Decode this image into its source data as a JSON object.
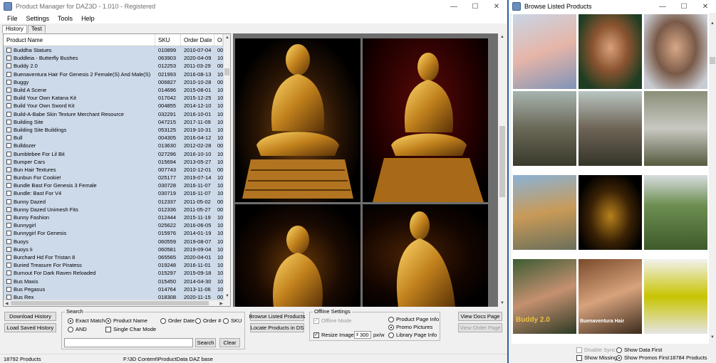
{
  "main": {
    "title": "Product Manager for DAZ3D  -  1.010  -  Registered",
    "menu": [
      "File",
      "Settings",
      "Tools",
      "Help"
    ],
    "tabs": [
      "History",
      "Test"
    ],
    "columns": [
      "Product Name",
      "SKU",
      "Order Date",
      "Or"
    ],
    "rows": [
      [
        "Buddha Statues",
        "010899",
        "2010-07-04",
        "00"
      ],
      [
        "Buddleia - Butterfly Bushes",
        "063903",
        "2020-04-09",
        "10"
      ],
      [
        "Buddy 2.0",
        "012253",
        "2011-03-29",
        "00"
      ],
      [
        "Buenaventura Hair For Genesis 2 Female(S) And Male(S)",
        "021993",
        "2016-08-13",
        "10"
      ],
      [
        "Buggy",
        "006827",
        "2010-10-28",
        "00"
      ],
      [
        "Build A Scene",
        "014696",
        "2015-08-01",
        "10"
      ],
      [
        "Build Your Own Katana Kit",
        "017042",
        "2015-12-25",
        "10"
      ],
      [
        "Build Your Own Sword Kit",
        "004855",
        "2014-12-10",
        "10"
      ],
      [
        "Build-A-Babe Skin Texture Merchant Resource",
        "032291",
        "2016-10-01",
        "10"
      ],
      [
        "Building Site",
        "047215",
        "2017-11-09",
        "10"
      ],
      [
        "Building Site Buildings",
        "053125",
        "2019-10-31",
        "10"
      ],
      [
        "Bull",
        "004305",
        "2016-04-12",
        "10"
      ],
      [
        "Bulldozer",
        "013630",
        "2012-02-28",
        "00"
      ],
      [
        "Bumblebee For Lil Bit",
        "027296",
        "2016-10-10",
        "10"
      ],
      [
        "Bumper Cars",
        "015694",
        "2013-05-27",
        "10"
      ],
      [
        "Bun Hair Textures",
        "007743",
        "2010-12-01",
        "00"
      ],
      [
        "Bunbun For Cookie!",
        "025177",
        "2019-07-14",
        "10"
      ],
      [
        "Bundle Bast For Genesis 3 Female",
        "030728",
        "2016-11-07",
        "10"
      ],
      [
        "Bundle: Bast For V4",
        "030719",
        "2016-11-07",
        "10"
      ],
      [
        "Bunny Dazed",
        "012337",
        "2011-05-02",
        "00"
      ],
      [
        "Bunny Dazed Unimesh Fits",
        "012336",
        "2011-05-27",
        "00"
      ],
      [
        "Bunny Fashion",
        "012444",
        "2015-11-19",
        "10"
      ],
      [
        "Bunnygirl",
        "025622",
        "2016-06-05",
        "10"
      ],
      [
        "Bunnygirl For Genesis",
        "015976",
        "2014-01-19",
        "10"
      ],
      [
        "Buoys",
        "060559",
        "2019-08-07",
        "10"
      ],
      [
        "Buoys Ii",
        "060581",
        "2019-09-04",
        "10"
      ],
      [
        "Burchard Hd For Tristan 8",
        "065565",
        "2020-04-01",
        "10"
      ],
      [
        "Buried Treasure For Piratess",
        "019248",
        "2016-11-01",
        "10"
      ],
      [
        "Burnout For Dark Raven Reloaded",
        "015297",
        "2015-09-18",
        "10"
      ],
      [
        "Bus Maxis",
        "015450",
        "2014-04-30",
        "10"
      ],
      [
        "Bus Pegasus",
        "014764",
        "2013-11-06",
        "10"
      ],
      [
        "Bus Rex",
        "018308",
        "2020-11-15",
        "00"
      ]
    ],
    "buttons": {
      "download_history": "Download History",
      "load_saved_history": "Load Saved History",
      "search": "Search",
      "clear": "Clear",
      "browse_listed": "Browse Listed Products",
      "locate_in_ds": "Locate Products in DS",
      "view_docs": "View Docs Page",
      "view_order": "View Order Page"
    },
    "search_group": {
      "label": "Search",
      "exact_match": "Exact Match",
      "and": "AND",
      "product_name": "Product Name",
      "single_char_mode": "Single Char Mode",
      "order_date": "Order Date",
      "order_no": "Order #",
      "sku": "SKU",
      "input_value": ""
    },
    "offline_group": {
      "label": "Offline Settings",
      "offline_mode": "Offline Mode",
      "resize_images": "Resize Images",
      "resize_value": "300",
      "resize_unit": "px/w",
      "product_page_info": "Product Page Info",
      "promo_pictures": "Promo Pictures",
      "library_page_info": "Library Page Info"
    },
    "status": {
      "count": "18792 Products",
      "path": "F:\\3D Content\\ProductData DAZ base"
    }
  },
  "browse": {
    "title": "Browse Listed Products",
    "thumbnail_captions": [
      "Buddy 2.0",
      "Buenaventura Hair"
    ],
    "disable_sync": "Disable Sync",
    "show_missing": "Show Missing",
    "show_data_first": "Show Data First",
    "show_promos_first": "Show Promos First",
    "count": "18784 Products"
  }
}
